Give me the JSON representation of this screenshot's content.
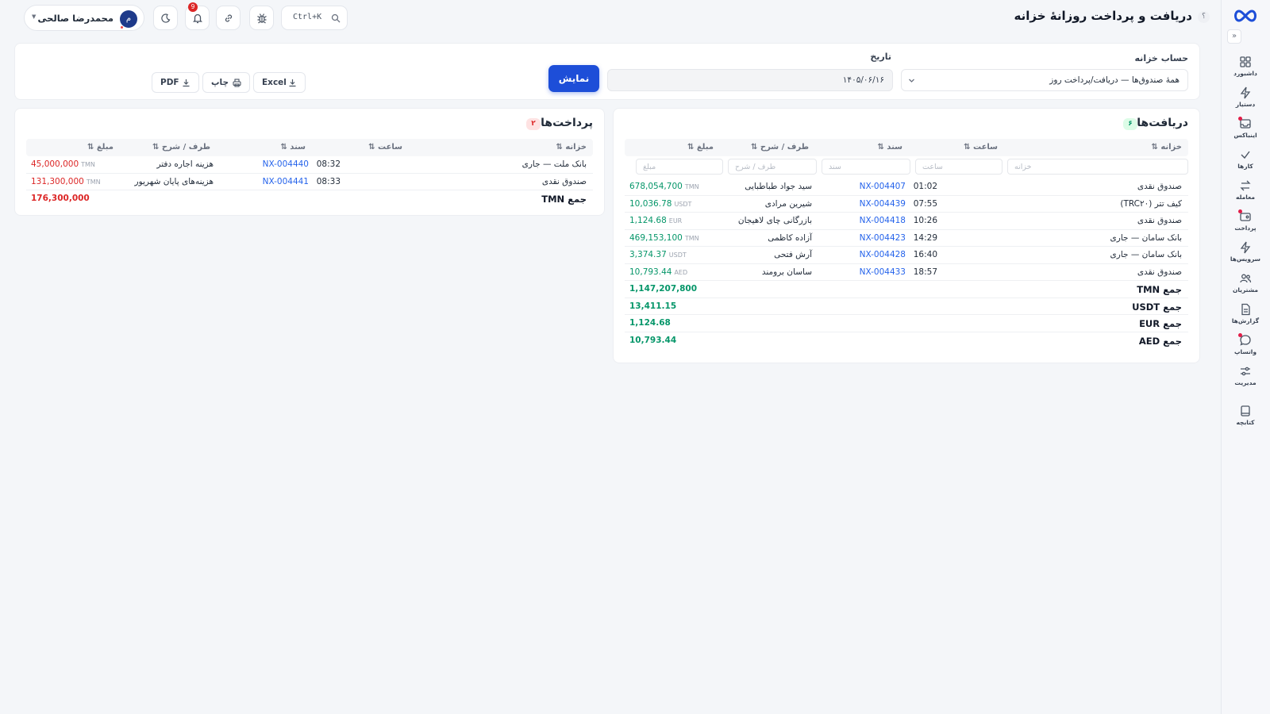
{
  "header": {
    "title": "دریافت و پرداخت روزانهٔ خزانه",
    "help": "؟",
    "search_shortcut": "Ctrl+K",
    "notification_count": "9",
    "user_name": "محمدرضا صالحی",
    "user_initial": "م"
  },
  "sidebar": {
    "collapse": "»",
    "items": [
      {
        "label": "داشبورد",
        "icon": "grid-icon"
      },
      {
        "label": "دستیار",
        "icon": "bolt-icon"
      },
      {
        "label": "اینباکس",
        "icon": "inbox-icon"
      },
      {
        "label": "کارها",
        "icon": "check-icon"
      },
      {
        "label": "معامله",
        "icon": "exchange-icon"
      },
      {
        "label": "پرداخت",
        "icon": "wallet-icon"
      },
      {
        "label": "سرویس‌ها",
        "icon": "bolt-icon"
      },
      {
        "label": "مشتریان",
        "icon": "users-icon"
      },
      {
        "label": "گزارش‌ها",
        "icon": "report-icon"
      },
      {
        "label": "واتساپ",
        "icon": "chat-icon"
      },
      {
        "label": "مدیریت",
        "icon": "sliders-icon"
      },
      {
        "label": "کتابچه",
        "icon": "book-icon"
      }
    ]
  },
  "filters": {
    "account_label": "حساب خزانه",
    "account_value": "همهٔ صندوق‌ها — دریافت/پرداخت روز",
    "date_label": "تاریخ",
    "date_value": "۱۴۰۵/۰۶/۱۶",
    "show_button": "نمایش",
    "excel_label": "Excel",
    "print_label": "چاپ",
    "pdf_label": "PDF"
  },
  "receipts": {
    "title": "دریافت‌ها",
    "count": "۶",
    "columns": {
      "treasury": "خزانه ⇅",
      "time": "ساعت ⇅",
      "doc": "سند ⇅",
      "party": "طرف / شرح ⇅",
      "amount": "مبلغ ⇅"
    },
    "filter_placeholders": {
      "treasury": "خزانه",
      "time": "ساعت",
      "doc": "سند",
      "party": "طرف / شرح",
      "amount": "مبلغ"
    },
    "rows": [
      {
        "treasury": "صندوق نقدی",
        "time": "01:02",
        "doc": "NX-004407",
        "party": "سید جواد طباطبایی",
        "amount": "678,054,700",
        "currency": "TMN"
      },
      {
        "treasury": "کیف تتر (TRC۲۰)",
        "time": "07:55",
        "doc": "NX-004439",
        "party": "شیرین مرادی",
        "amount": "10,036.78",
        "currency": "USDT"
      },
      {
        "treasury": "صندوق نقدی",
        "time": "10:26",
        "doc": "NX-004418",
        "party": "بازرگانی چای لاهیجان",
        "amount": "1,124.68",
        "currency": "EUR"
      },
      {
        "treasury": "بانک سامان — جاری",
        "time": "14:29",
        "doc": "NX-004423",
        "party": "آزاده کاظمی",
        "amount": "469,153,100",
        "currency": "TMN"
      },
      {
        "treasury": "بانک سامان — جاری",
        "time": "16:40",
        "doc": "NX-004428",
        "party": "آرش فتحی",
        "amount": "3,374.37",
        "currency": "USDT"
      },
      {
        "treasury": "صندوق نقدی",
        "time": "18:57",
        "doc": "NX-004433",
        "party": "ساسان برومند",
        "amount": "10,793.44",
        "currency": "AED"
      }
    ],
    "totals": [
      {
        "label": "جمع TMN",
        "value": "1,147,207,800"
      },
      {
        "label": "جمع USDT",
        "value": "13,411.15"
      },
      {
        "label": "جمع EUR",
        "value": "1,124.68"
      },
      {
        "label": "جمع AED",
        "value": "10,793.44"
      }
    ]
  },
  "payments": {
    "title": "پرداخت‌ها",
    "count": "۲",
    "columns": {
      "treasury": "خزانه ⇅",
      "time": "ساعت ⇅",
      "doc": "سند ⇅",
      "party": "طرف / شرح ⇅",
      "amount": "مبلغ ⇅"
    },
    "rows": [
      {
        "treasury": "بانک ملت — جاری",
        "time": "08:32",
        "doc": "NX-004440",
        "party": "هزینه اجاره دفتر",
        "amount": "45,000,000",
        "currency": "TMN"
      },
      {
        "treasury": "صندوق نقدی",
        "time": "08:33",
        "doc": "NX-004441",
        "party": "هزینه‌های پایان شهریور",
        "amount": "131,300,000",
        "currency": "TMN"
      }
    ],
    "totals": [
      {
        "label": "جمع TMN",
        "value": "176,300,000"
      }
    ]
  },
  "colors": {
    "accent": "#1d4ed8",
    "receipt": "#059669",
    "payment": "#dc2626"
  }
}
